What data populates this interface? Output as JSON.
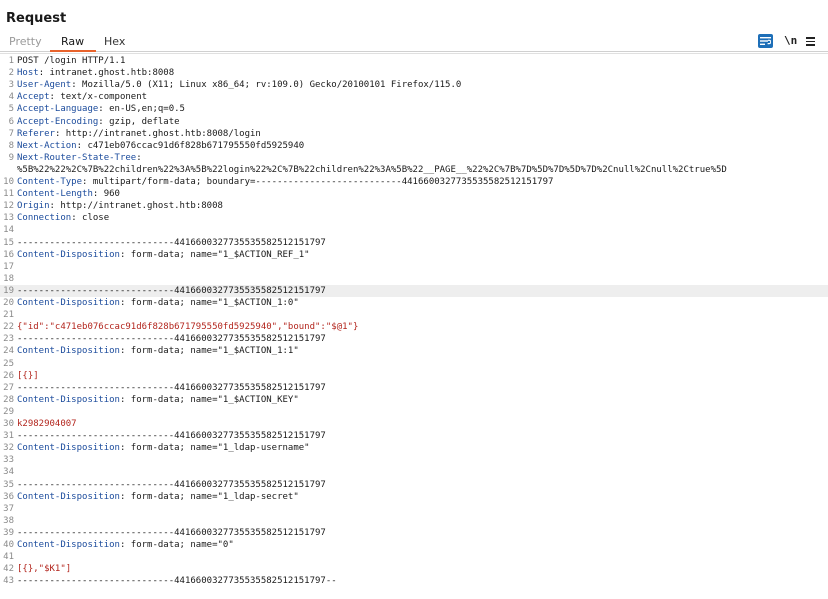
{
  "title": "Request",
  "tabs": [
    {
      "label": "Pretty",
      "active": false
    },
    {
      "label": "Raw",
      "active": true
    },
    {
      "label": "Hex",
      "active": false
    }
  ],
  "toolbar": {
    "wrap_icon": "word-wrap-icon",
    "newline_label": "\\n",
    "menu_icon": "hamburger-menu-icon"
  },
  "colors": {
    "accent_tab_underline": "#e8632c",
    "header_name": "#1b4b9c",
    "body_value": "#b3261e",
    "wrap_button": "#1e6fb8"
  },
  "lines": [
    {
      "n": "1",
      "name": "",
      "value": "POST /login HTTP/1.1"
    },
    {
      "n": "2",
      "name": "Host",
      "value": ": intranet.ghost.htb:8008"
    },
    {
      "n": "3",
      "name": "User-Agent",
      "value": ": Mozilla/5.0 (X11; Linux x86_64; rv:109.0) Gecko/20100101 Firefox/115.0"
    },
    {
      "n": "4",
      "name": "Accept",
      "value": ": text/x-component"
    },
    {
      "n": "5",
      "name": "Accept-Language",
      "value": ": en-US,en;q=0.5"
    },
    {
      "n": "6",
      "name": "Accept-Encoding",
      "value": ": gzip, deflate"
    },
    {
      "n": "7",
      "name": "Referer",
      "value": ": http://intranet.ghost.htb:8008/login"
    },
    {
      "n": "8",
      "name": "Next-Action",
      "value": ": c471eb076ccac91d6f828b671795550fd5925940"
    },
    {
      "n": "9",
      "name": "Next-Router-State-Tree",
      "value": ":"
    },
    {
      "n": "",
      "name": "",
      "value": "%5B%22%22%2C%7B%22children%22%3A%5B%22login%22%2C%7B%22children%22%3A%5B%22__PAGE__%22%2C%7B%7D%5D%7D%5D%7D%2Cnull%2Cnull%2Ctrue%5D"
    },
    {
      "n": "10",
      "name": "Content-Type",
      "value": ": multipart/form-data; boundary=---------------------------4416600327735535582512151797"
    },
    {
      "n": "11",
      "name": "Content-Length",
      "value": ": 960"
    },
    {
      "n": "12",
      "name": "Origin",
      "value": ": http://intranet.ghost.htb:8008"
    },
    {
      "n": "13",
      "name": "Connection",
      "value": ": close"
    },
    {
      "n": "14",
      "name": "",
      "value": ""
    },
    {
      "n": "15",
      "name": "",
      "value": "-----------------------------4416600327735535582512151797"
    },
    {
      "n": "16",
      "name": "Content-Disposition",
      "value": ": form-data; name=\"1_$ACTION_REF_1\""
    },
    {
      "n": "17",
      "name": "",
      "value": ""
    },
    {
      "n": "18",
      "name": "",
      "value": ""
    },
    {
      "n": "19",
      "name": "",
      "value": "-----------------------------4416600327735535582512151797",
      "hl": true
    },
    {
      "n": "20",
      "name": "Content-Disposition",
      "value": ": form-data; name=\"1_$ACTION_1:0\""
    },
    {
      "n": "21",
      "name": "",
      "value": ""
    },
    {
      "n": "22",
      "name": "",
      "value": "{\"id\":\"c471eb076ccac91d6f828b671795550fd5925940\",\"bound\":\"$@1\"}",
      "red": true
    },
    {
      "n": "23",
      "name": "",
      "value": "-----------------------------4416600327735535582512151797"
    },
    {
      "n": "24",
      "name": "Content-Disposition",
      "value": ": form-data; name=\"1_$ACTION_1:1\""
    },
    {
      "n": "25",
      "name": "",
      "value": ""
    },
    {
      "n": "26",
      "name": "",
      "value": "[{}]",
      "red": true
    },
    {
      "n": "27",
      "name": "",
      "value": "-----------------------------4416600327735535582512151797"
    },
    {
      "n": "28",
      "name": "Content-Disposition",
      "value": ": form-data; name=\"1_$ACTION_KEY\""
    },
    {
      "n": "29",
      "name": "",
      "value": ""
    },
    {
      "n": "30",
      "name": "",
      "value": "k2982904007",
      "red": true
    },
    {
      "n": "31",
      "name": "",
      "value": "-----------------------------4416600327735535582512151797"
    },
    {
      "n": "32",
      "name": "Content-Disposition",
      "value": ": form-data; name=\"1_ldap-username\""
    },
    {
      "n": "33",
      "name": "",
      "value": ""
    },
    {
      "n": "34",
      "name": "",
      "value": ""
    },
    {
      "n": "35",
      "name": "",
      "value": "-----------------------------4416600327735535582512151797"
    },
    {
      "n": "36",
      "name": "Content-Disposition",
      "value": ": form-data; name=\"1_ldap-secret\""
    },
    {
      "n": "37",
      "name": "",
      "value": ""
    },
    {
      "n": "38",
      "name": "",
      "value": ""
    },
    {
      "n": "39",
      "name": "",
      "value": "-----------------------------4416600327735535582512151797"
    },
    {
      "n": "40",
      "name": "Content-Disposition",
      "value": ": form-data; name=\"0\""
    },
    {
      "n": "41",
      "name": "",
      "value": ""
    },
    {
      "n": "42",
      "name": "",
      "value": "[{},\"$K1\"]",
      "red": true
    },
    {
      "n": "43",
      "name": "",
      "value": "-----------------------------4416600327735535582512151797--"
    }
  ]
}
